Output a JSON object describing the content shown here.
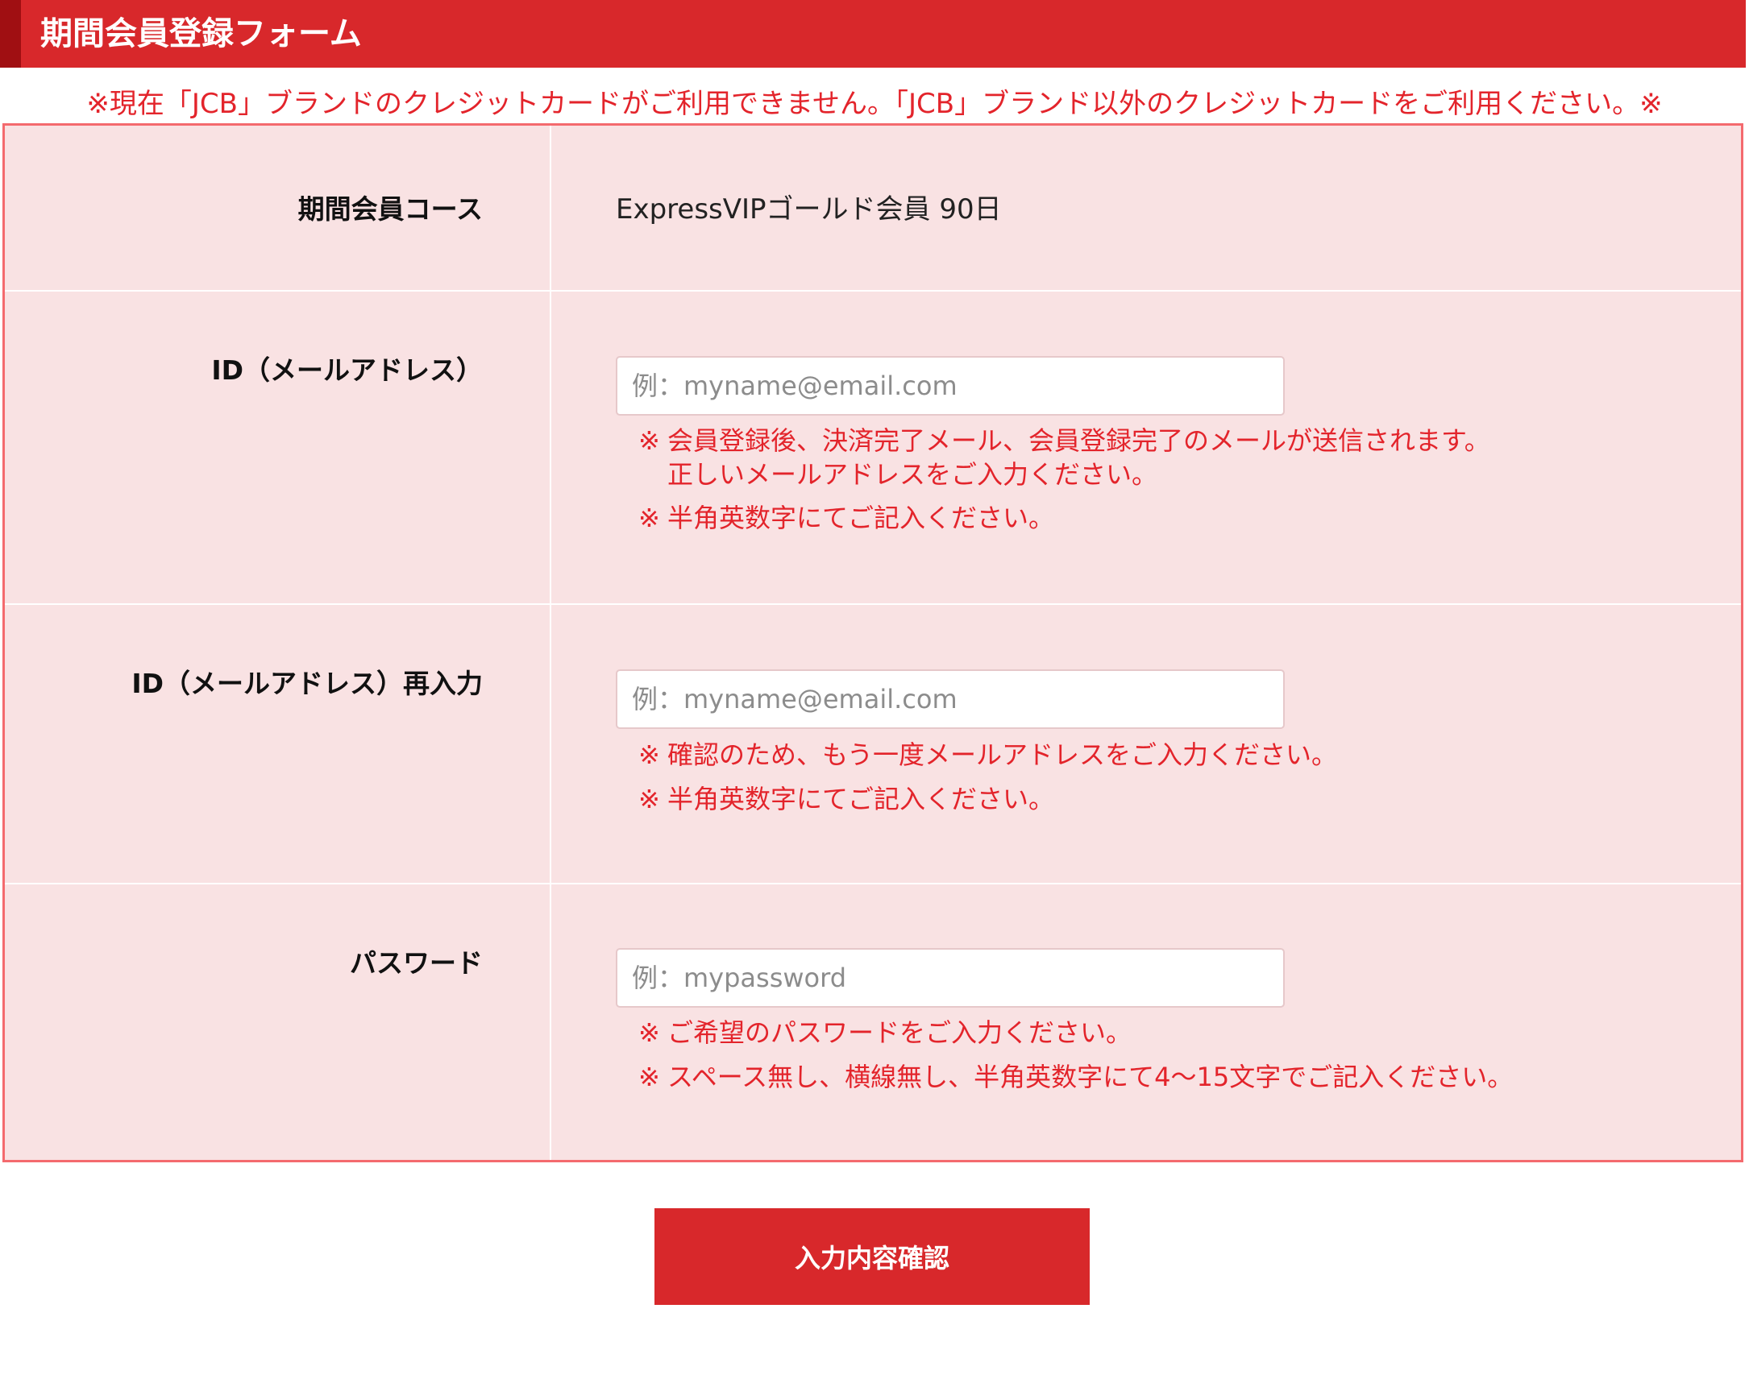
{
  "header": {
    "title": "期間会員登録フォーム"
  },
  "notice": "※現在「JCB」ブランドのクレジットカードがご利用できません。「JCB」ブランド以外のクレジットカードをご利用ください。※",
  "form": {
    "course": {
      "label": "期間会員コース",
      "value": "ExpressVIPゴールド会員 90日"
    },
    "email": {
      "label": "ID（メールアドレス）",
      "placeholder": "例：myname@email.com",
      "value": "",
      "notes": [
        {
          "mark": "※",
          "text": "会員登録後、決済完了メール、会員登録完了のメールが送信されます。",
          "cont": "正しいメールアドレスをご入力ください。"
        },
        {
          "mark": "※",
          "text": "半角英数字にてご記入ください。"
        }
      ]
    },
    "email_confirm": {
      "label": "ID（メールアドレス）再入力",
      "placeholder": "例：myname@email.com",
      "value": "",
      "notes": [
        {
          "mark": "※",
          "text": "確認のため、もう一度メールアドレスをご入力ください。"
        },
        {
          "mark": "※",
          "text": "半角英数字にてご記入ください。"
        }
      ]
    },
    "password": {
      "label": "パスワード",
      "placeholder": "例：mypassword",
      "value": "",
      "notes": [
        {
          "mark": "※",
          "text": "ご希望のパスワードをご入力ください。"
        },
        {
          "mark": "※",
          "text": "スペース無し、横線無し、半角英数字にて4～15文字でご記入ください。"
        }
      ]
    }
  },
  "submit_label": "入力内容確認",
  "colors": {
    "brand_red": "#d8282b",
    "notice_red": "#e3242b",
    "form_bg": "#f9e2e3",
    "form_border": "#f46a6e"
  }
}
